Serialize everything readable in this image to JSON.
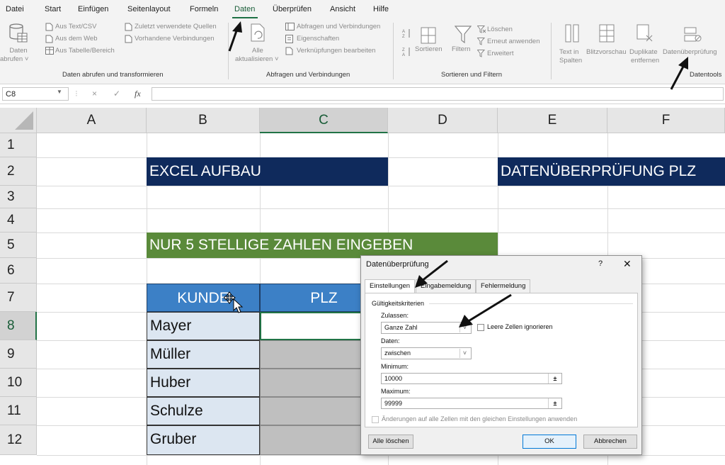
{
  "ribbon_tabs": [
    "Datei",
    "Start",
    "Einfügen",
    "Seitenlayout",
    "Formeln",
    "Daten",
    "Überprüfen",
    "Ansicht",
    "Hilfe"
  ],
  "active_tab": "Daten",
  "groups": {
    "get_data": {
      "label": "Daten abrufen und transformieren",
      "big_button": "Daten abrufen ˅",
      "big_button_line1": "Daten",
      "big_button_line2": "abrufen ˅",
      "buttons": [
        "Aus Text/CSV",
        "Aus dem Web",
        "Aus Tabelle/Bereich",
        "Zuletzt verwendete Quellen",
        "Vorhandene Verbindungen"
      ]
    },
    "queries": {
      "label": "Abfragen und Verbindungen",
      "big_button_line1": "Alle",
      "big_button_line2": "aktualisieren ˅",
      "buttons": [
        "Abfragen und Verbindungen",
        "Eigenschaften",
        "Verknüpfungen bearbeiten"
      ]
    },
    "sort_filter": {
      "label": "Sortieren und Filtern",
      "sort": "Sortieren",
      "filter": "Filtern",
      "buttons": [
        "Löschen",
        "Erneut anwenden",
        "Erweitert"
      ]
    },
    "data_tools": {
      "label": "Datentools",
      "text_to_columns_line1": "Text in",
      "text_to_columns_line2": "Spalten",
      "flash_fill": "Blitzvorschau",
      "remove_dup_line1": "Duplikate",
      "remove_dup_line2": "entfernen",
      "validation": "Datenüberprüfung"
    }
  },
  "formula_bar": {
    "name_box": "C8",
    "cancel": "×",
    "enter": "✓",
    "fx": "fx",
    "value": ""
  },
  "sheet": {
    "columns": [
      "A",
      "B",
      "C",
      "D",
      "E",
      "F"
    ],
    "rows": [
      "1",
      "2",
      "3",
      "4",
      "5",
      "6",
      "7",
      "8",
      "9",
      "10",
      "11",
      "12"
    ],
    "selected_column": "C",
    "selected_row": "8",
    "title_banner": "EXCEL AUFBAU",
    "right_banner": "DATENÜBERPRÜFUNG PLZ",
    "instruction_banner": "NUR 5 STELLIGE ZAHLEN EINGEBEN",
    "table_headers": [
      "KUNDE",
      "PLZ"
    ],
    "customers": [
      "Mayer",
      "Müller",
      "Huber",
      "Schulze",
      "Gruber"
    ]
  },
  "dialog": {
    "title": "Datenüberprüfung",
    "help": "?",
    "close": "✕",
    "tabs": [
      "Einstellungen",
      "Eingabemeldung",
      "Fehlermeldung"
    ],
    "active_tab": "Einstellungen",
    "section": "Gültigkeitskriterien",
    "allow_label": "Zulassen:",
    "allow_value": "Ganze Zahl",
    "ignore_blank": "Leere Zellen ignorieren",
    "data_label": "Daten:",
    "data_value": "zwischen",
    "min_label": "Minimum:",
    "min_value": "10000",
    "max_label": "Maximum:",
    "max_value": "99999",
    "apply_all": "Änderungen auf alle Zellen mit den gleichen Einstellungen anwenden",
    "clear_all": "Alle löschen",
    "ok": "OK",
    "cancel": "Abbrechen"
  },
  "colors": {
    "banner_navy": "#0f2a5c",
    "banner_green": "#5a8a3a",
    "header_blue": "#3c80c6",
    "name_fill": "#dce6f1",
    "plz_fill": "#bfbfbf",
    "excel_green": "#217346"
  }
}
